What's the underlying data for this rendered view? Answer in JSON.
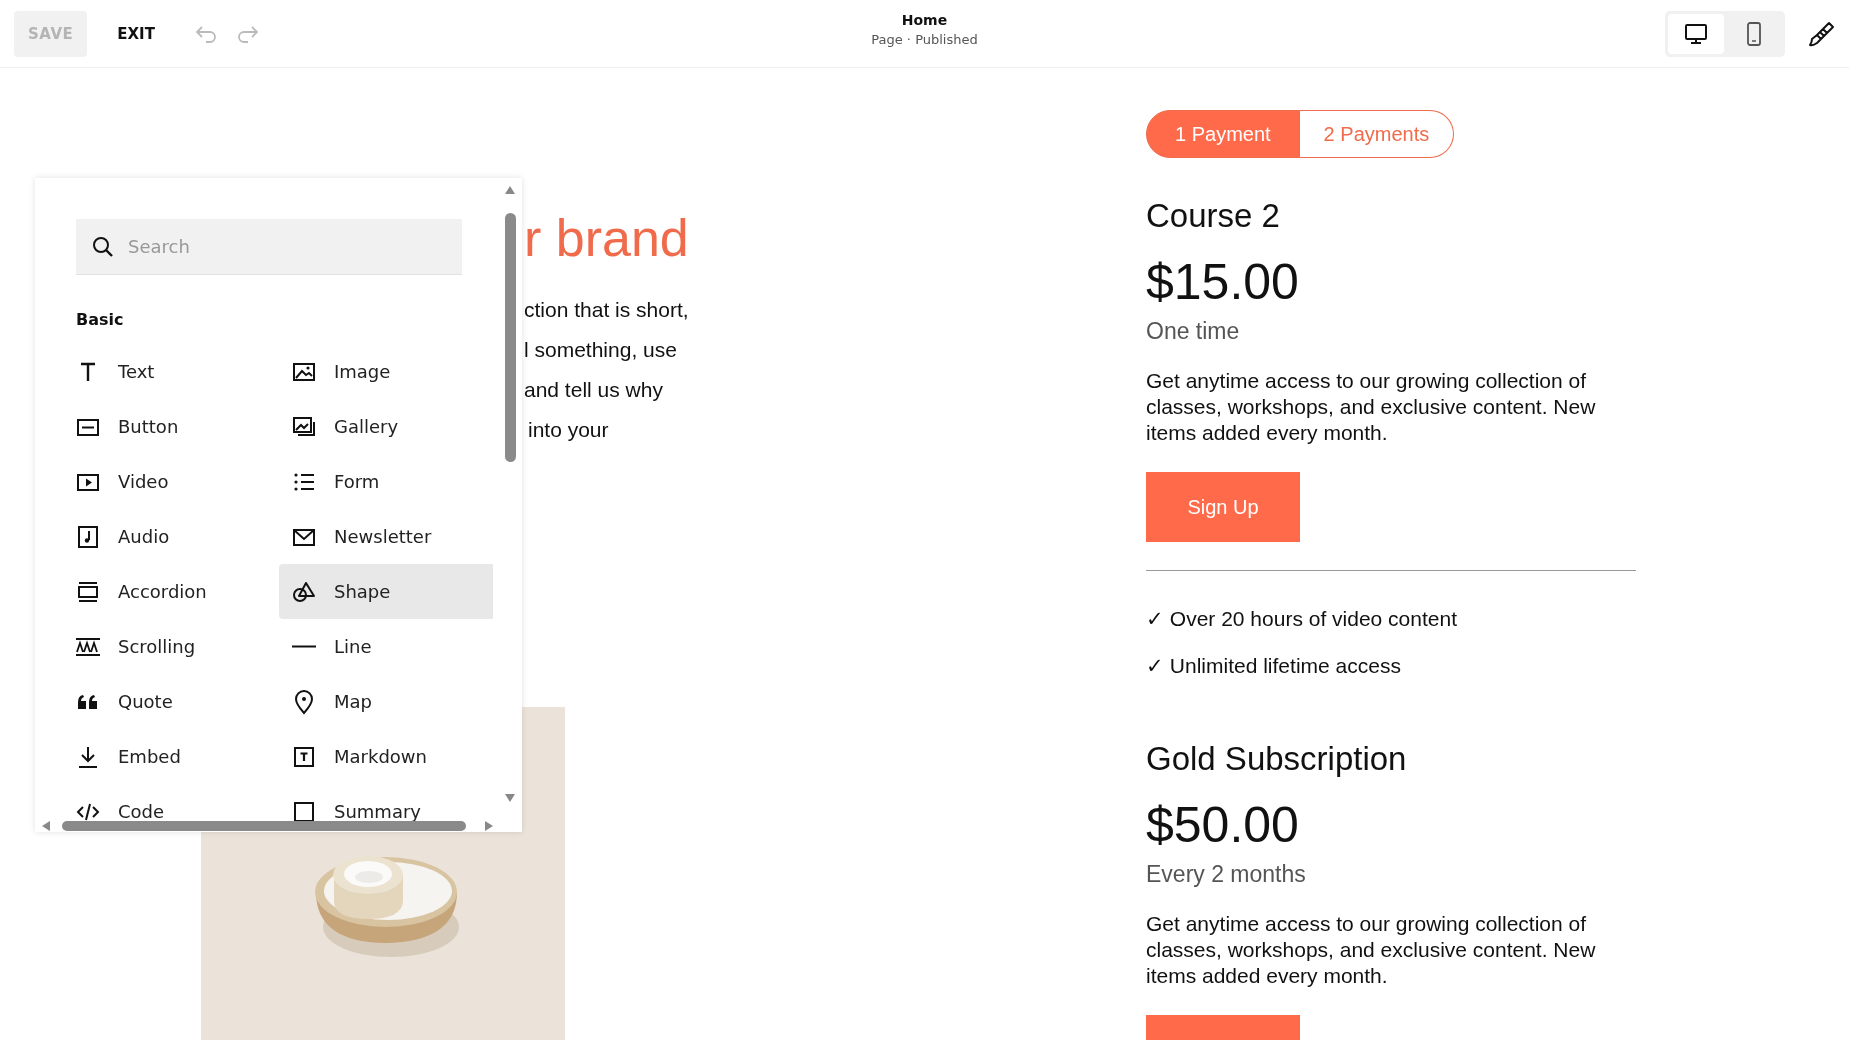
{
  "toolbar": {
    "save": {
      "label": "SAVE",
      "disabled": true
    },
    "exit": {
      "label": "EXIT"
    },
    "title": "Home",
    "subtitle": "Page · Published",
    "devices": [
      {
        "kind": "desktop",
        "selected": true
      },
      {
        "kind": "mobile",
        "selected": false
      }
    ]
  },
  "page_left": {
    "heading": "r brand",
    "lines": [
      "ction that is short,",
      "l something, use",
      "and tell us why",
      "into your"
    ]
  },
  "block_panel": {
    "search": {
      "placeholder": "Search"
    },
    "section": "Basic",
    "blocks": [
      {
        "label": "Text",
        "selected": false
      },
      {
        "label": "Image",
        "selected": false
      },
      {
        "label": "Button",
        "selected": false
      },
      {
        "label": "Gallery",
        "selected": false
      },
      {
        "label": "Video",
        "selected": false
      },
      {
        "label": "Form",
        "selected": false
      },
      {
        "label": "Audio",
        "selected": false
      },
      {
        "label": "Newsletter",
        "selected": false
      },
      {
        "label": "Accordion",
        "selected": false
      },
      {
        "label": "Shape",
        "selected": true
      },
      {
        "label": "Scrolling",
        "selected": false
      },
      {
        "label": "Line",
        "selected": false
      },
      {
        "label": "Quote",
        "selected": false
      },
      {
        "label": "Map",
        "selected": false
      },
      {
        "label": "Embed",
        "selected": false
      },
      {
        "label": "Markdown",
        "selected": false
      },
      {
        "label": "Code",
        "selected": false
      },
      {
        "label": "Summary",
        "selected": false
      }
    ]
  },
  "payment_tabs": [
    {
      "label": "1 Payment",
      "selected": true
    },
    {
      "label": "2 Payments",
      "selected": false
    }
  ],
  "plans": [
    {
      "name": "Course 2",
      "price": "$15.00",
      "period": "One time",
      "description": "Get anytime access to our growing collection of classes, workshops, and exclusive content. New items added every month.",
      "button": "Sign Up",
      "features": [
        "✓ Over 20 hours of video content",
        "✓ Unlimited lifetime access"
      ]
    },
    {
      "name": "Gold Subscription",
      "price": "$50.00",
      "period": "Every 2 months",
      "description": "Get anytime access to our growing collection of classes, workshops, and exclusive content. New items added every month.",
      "button_partial": true
    }
  ]
}
